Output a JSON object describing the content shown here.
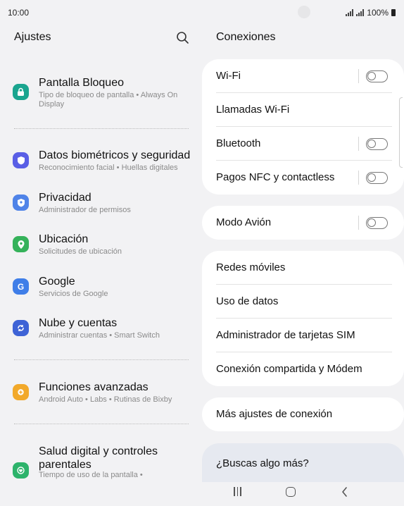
{
  "status": {
    "time": "10:00",
    "battery": "100%"
  },
  "left_pane": {
    "title": "Ajustes",
    "items": [
      {
        "title": "Pantalla Bloqueo",
        "subtitle": "Tipo de bloqueo de pantalla  •  Always On Display",
        "icon": "lock-icon",
        "color": "#1aa58f"
      },
      {
        "title": "Datos biométricos y seguridad",
        "subtitle": "Reconocimiento facial  •  Huellas digitales",
        "icon": "shield-icon",
        "color": "#5a5fe6"
      },
      {
        "title": "Privacidad",
        "subtitle": "Administrador de permisos",
        "icon": "privacy-icon",
        "color": "#4f83e8"
      },
      {
        "title": "Ubicación",
        "subtitle": "Solicitudes de ubicación",
        "icon": "location-icon",
        "color": "#35b25a"
      },
      {
        "title": "Google",
        "subtitle": "Servicios de Google",
        "icon": "google-icon",
        "color": "#3f7ee8"
      },
      {
        "title": "Nube y cuentas",
        "subtitle": "Administrar cuentas  •  Smart Switch",
        "icon": "sync-icon",
        "color": "#3e63d6"
      },
      {
        "title": "Funciones avanzadas",
        "subtitle": "Android Auto  •  Labs  •  Rutinas de Bixby",
        "icon": "gear-plus-icon",
        "color": "#f2a92a"
      },
      {
        "title": "Salud digital y controles parentales",
        "subtitle": "Tiempo de uso de la pantalla  •",
        "icon": "heart-icon",
        "color": "#2db36b"
      }
    ]
  },
  "right_pane": {
    "title": "Conexiones",
    "card1": [
      "Wi-Fi",
      "Llamadas Wi-Fi",
      "Bluetooth",
      "Pagos NFC y contactless"
    ],
    "card2": [
      "Modo Avión"
    ],
    "card3": [
      "Redes móviles",
      "Uso de datos",
      "Administrador de tarjetas SIM",
      "Conexión compartida y Módem"
    ],
    "card4": [
      "Más ajustes de conexión"
    ],
    "search_more": "¿Buscas algo más?"
  }
}
